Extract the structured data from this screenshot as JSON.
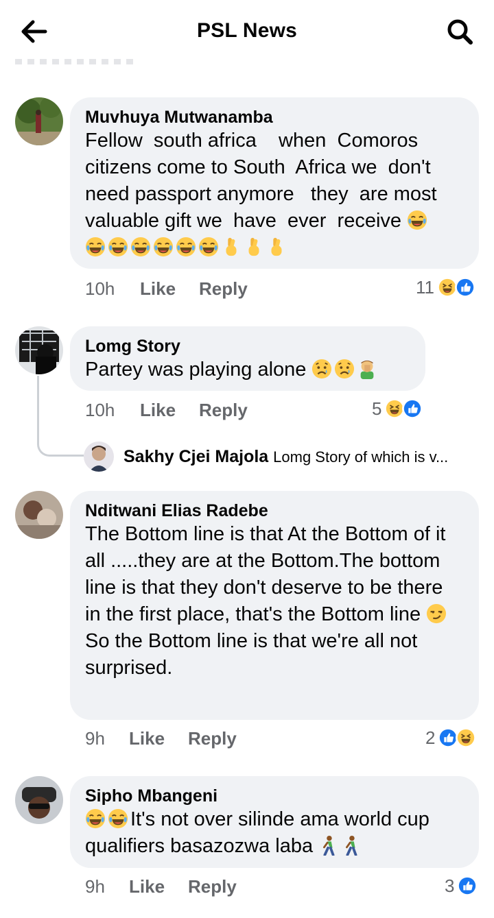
{
  "header": {
    "title": "PSL News",
    "back_icon": "arrow-left-icon",
    "search_icon": "search-icon"
  },
  "comments": [
    {
      "author": "Muvhuya Mutwanamba",
      "text": "Fellow  south africa    when  Comoros citizens come to South  Africa we  don't need passport anymore   they  are most valuable gift we  have  ever  receive",
      "emojis": [
        "laughing-crying",
        "laughing-crying",
        "laughing-crying",
        "laughing-crying",
        "laughing-crying",
        "laughing-crying",
        "laughing-crying",
        "crossed-fingers",
        "crossed-fingers",
        "crossed-fingers"
      ],
      "time": "10h",
      "like": "Like",
      "reply": "Reply",
      "reactions": "11"
    },
    {
      "author": "Lomg Story",
      "text": "Partey was playing alone",
      "emojis": [
        "sad-face",
        "sad-face",
        "facepalm-person"
      ],
      "time": "10h",
      "like": "Like",
      "reply": "Reply",
      "reactions": "5"
    },
    {
      "author": "Nditwani Elias Radebe",
      "text": "The Bottom line is that At the Bottom of it all .....they are at the Bottom.The bottom line is that they don't deserve to be there in the first place, that's the Bottom line",
      "text2": "So the Bottom line is that we're all not surprised.",
      "emojis": [
        "smirking-face"
      ],
      "time": "9h",
      "like": "Like",
      "reply": "Reply",
      "reactions": "2"
    },
    {
      "author": "Sipho Mbangeni",
      "text": "It's not over silinde ama world cup qualifiers basazozwa laba",
      "emojis": [
        "laughing-crying",
        "laughing-crying",
        "walking-person",
        "walking-person"
      ],
      "time": "9h",
      "like": "Like",
      "reply": "Reply",
      "reactions": "3"
    }
  ],
  "reply_preview": {
    "author": "Sakhy Cjei Majola",
    "text": "Lomg Story of which is v..."
  },
  "colors": {
    "bubble": "#f0f2f5",
    "meta": "#65676b",
    "like_blue": "#1877f2",
    "emoji_yellow": "#ffcb4c"
  }
}
